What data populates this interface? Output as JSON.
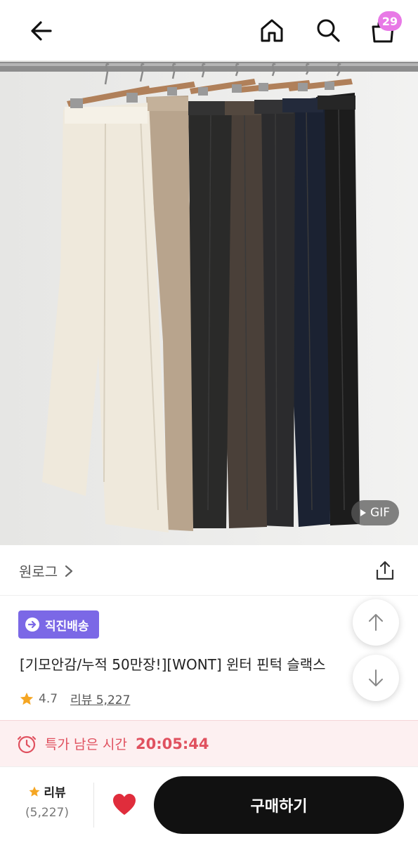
{
  "header": {
    "back_icon": "arrow-left-icon",
    "home_icon": "home-icon",
    "search_icon": "search-icon",
    "cart_icon": "shopping-bag-icon",
    "cart_count": "29",
    "badge_color": "#e879e6"
  },
  "hero": {
    "gif_label": "GIF"
  },
  "brand": {
    "name": "원로그",
    "chevron_icon": "chevron-right-icon",
    "share_icon": "share-icon"
  },
  "product": {
    "shipping_badge": "직진배송",
    "shipping_badge_color": "#7b68e6",
    "title": "[기모안감/누적 50만장!][WONT] 윈터 핀턱 슬랙스",
    "rating": "4.7",
    "review_link": "리뷰 5,227",
    "star_color": "#f5a623"
  },
  "scroll": {
    "up_icon": "arrow-up-icon",
    "down_icon": "arrow-down-icon"
  },
  "sale": {
    "clock_icon": "clock-icon",
    "label": "특가 남은 시간",
    "time": "20:05:44",
    "color": "#e0515f"
  },
  "bottom": {
    "review_label": "리뷰",
    "review_count": "(5,227)",
    "heart_icon": "heart-icon",
    "heart_color": "#e02d3c",
    "buy_label": "구매하기"
  }
}
